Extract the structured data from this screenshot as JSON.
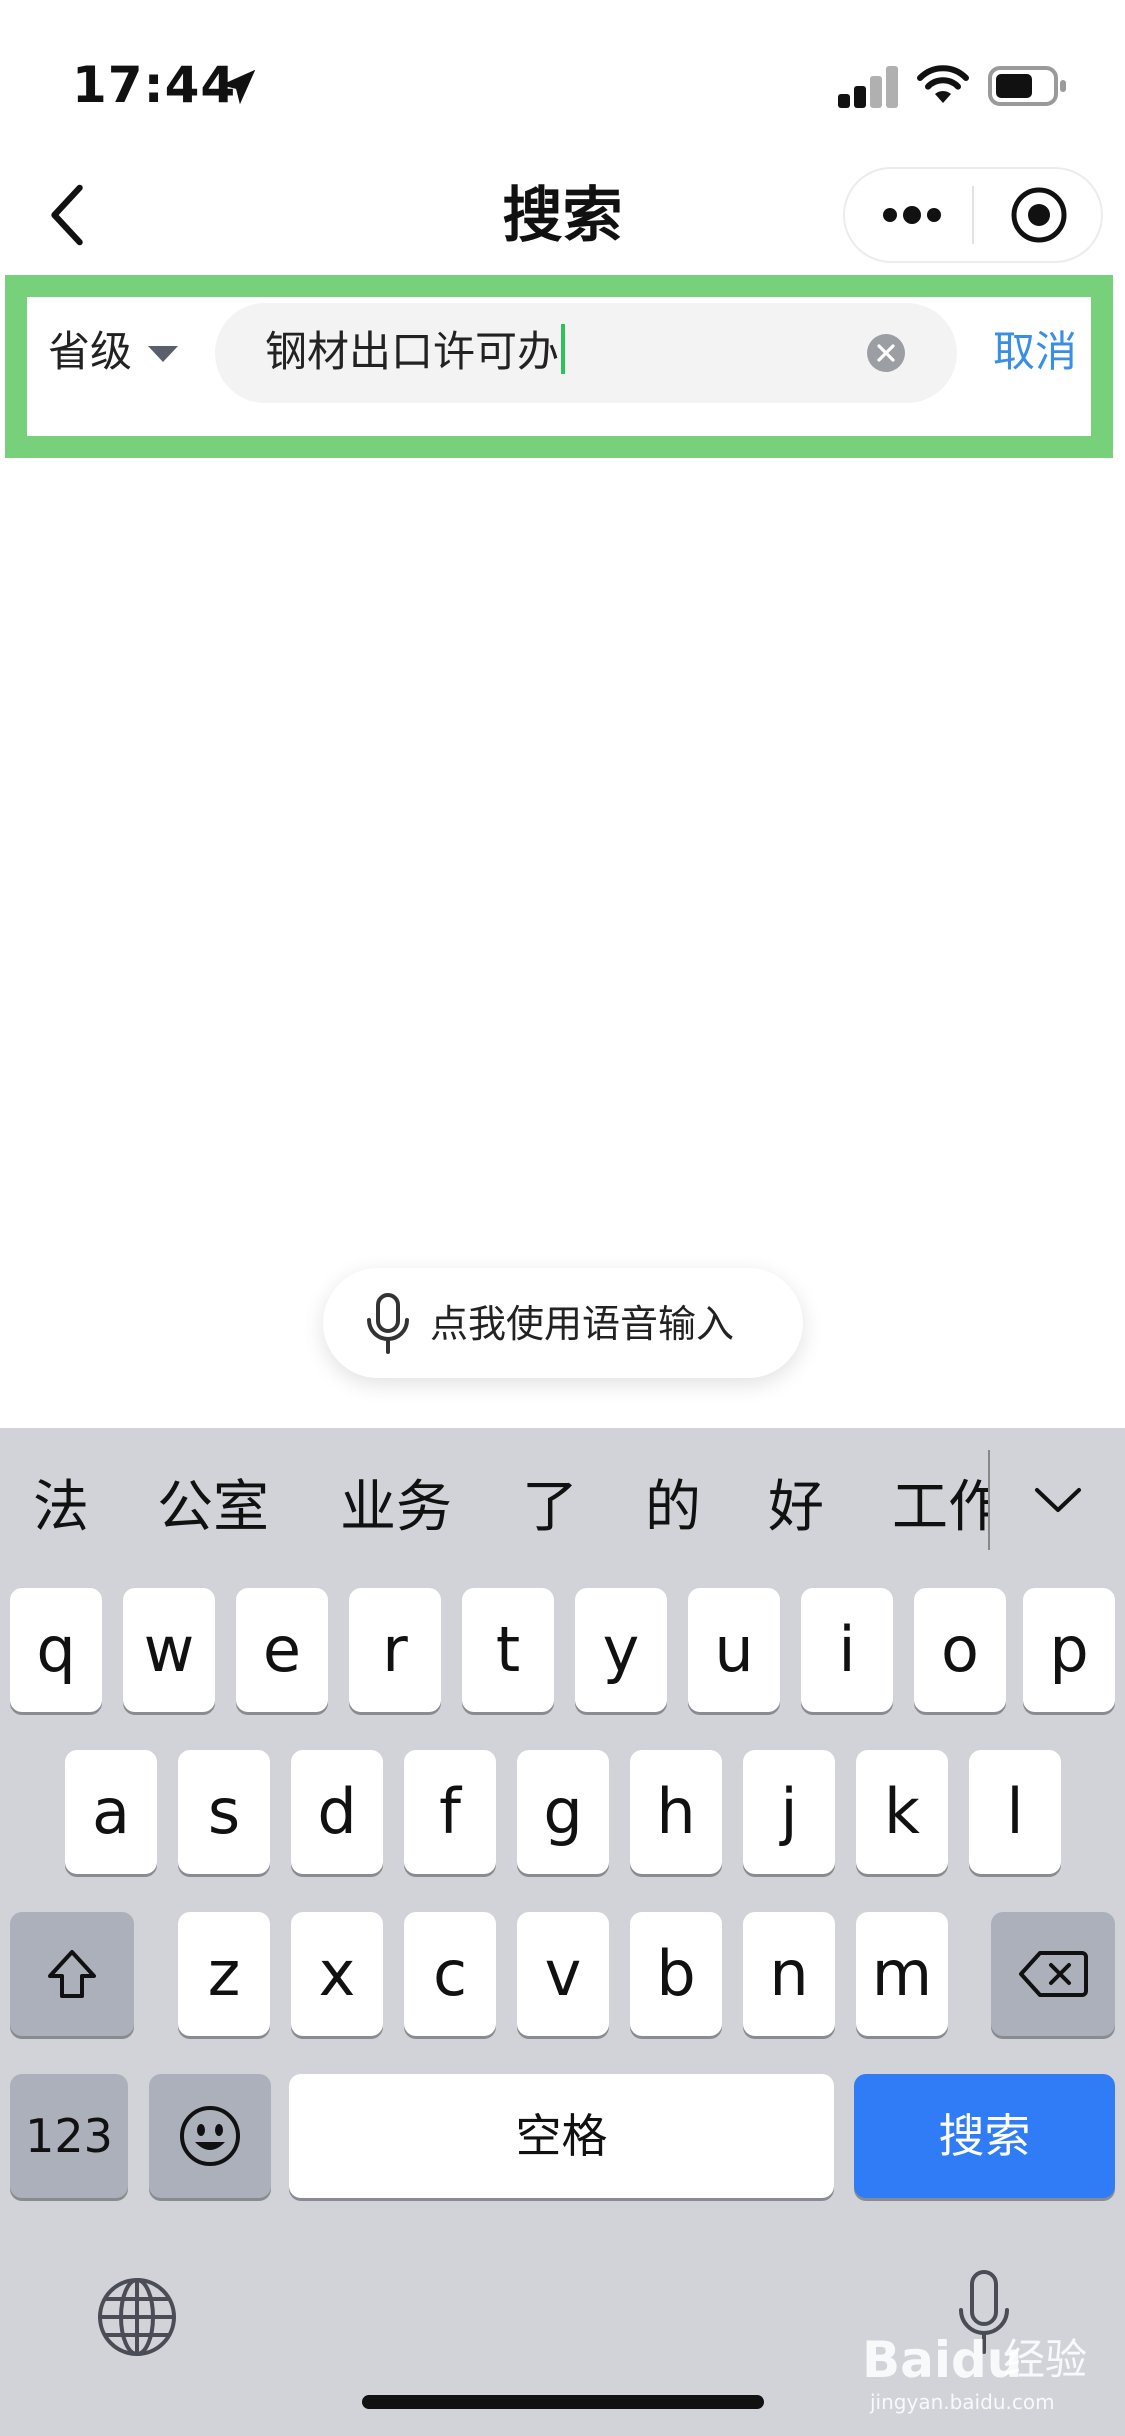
{
  "status_bar": {
    "time": "17:44"
  },
  "nav": {
    "title": "搜索"
  },
  "search": {
    "region_label": "省级",
    "query": "钢材出口许可办",
    "cancel_label": "取消"
  },
  "voice": {
    "label": "点我使用语音输入"
  },
  "keyboard": {
    "candidates": [
      "法",
      "公室",
      "业务",
      "了",
      "的",
      "好",
      "工作"
    ],
    "row1": [
      "q",
      "w",
      "e",
      "r",
      "t",
      "y",
      "u",
      "i",
      "o",
      "p"
    ],
    "row2": [
      "a",
      "s",
      "d",
      "f",
      "g",
      "h",
      "j",
      "k",
      "l"
    ],
    "row3": [
      "z",
      "x",
      "c",
      "v",
      "b",
      "n",
      "m"
    ],
    "numbers_label": "123",
    "space_label": "空格",
    "search_label": "搜索"
  },
  "watermark": {
    "brand": "Baidu",
    "jingyan": "经验",
    "url": "jingyan.baidu.com"
  },
  "colors": {
    "highlight": "#77d17a",
    "accent": "#3a8ee6",
    "search_key": "#2f7cf6"
  }
}
